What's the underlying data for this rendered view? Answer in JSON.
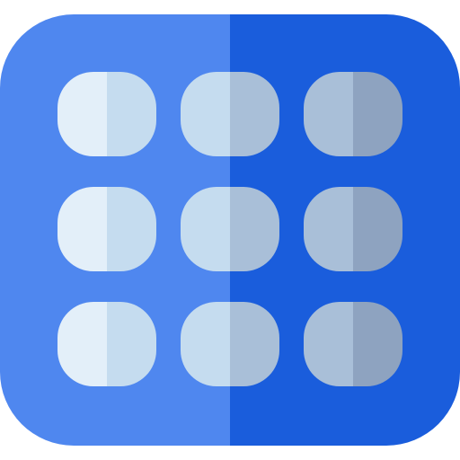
{
  "icon": {
    "name": "grid-keypad-icon",
    "rows": 3,
    "columns": 3,
    "colors": {
      "panel_left": "#4f87ef",
      "panel_right": "#1a5ddc",
      "key_lightest": "#e3eff9",
      "key_light": "#c5dcef",
      "key_mid": "#a9bfd8",
      "key_dark": "#8ea3c0"
    },
    "keys": [
      {
        "left": "key_lightest",
        "right": "key_light"
      },
      {
        "left": "key_light",
        "right": "key_mid"
      },
      {
        "left": "key_mid",
        "right": "key_dark"
      },
      {
        "left": "key_lightest",
        "right": "key_light"
      },
      {
        "left": "key_light",
        "right": "key_mid"
      },
      {
        "left": "key_mid",
        "right": "key_dark"
      },
      {
        "left": "key_lightest",
        "right": "key_light"
      },
      {
        "left": "key_light",
        "right": "key_mid"
      },
      {
        "left": "key_mid",
        "right": "key_dark"
      }
    ]
  }
}
